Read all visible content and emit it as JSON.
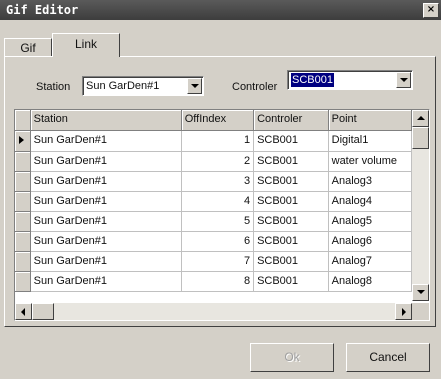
{
  "window": {
    "title": "Gif Editor",
    "close_glyph": "×"
  },
  "tabs": [
    {
      "label": "Gif",
      "active": false
    },
    {
      "label": "Link",
      "active": true
    }
  ],
  "filters": {
    "station_label": "Station",
    "station_value": "Sun GarDen#1",
    "controller_label": "Controler",
    "controller_value": "SCB001"
  },
  "table": {
    "columns": [
      "Station",
      "OffIndex",
      "Controler",
      "Point"
    ],
    "rows": [
      {
        "station": "Sun GarDen#1",
        "offindex": "1",
        "controller": "SCB001",
        "point": "Digital1",
        "current": true
      },
      {
        "station": "Sun GarDen#1",
        "offindex": "2",
        "controller": "SCB001",
        "point": "water volume",
        "current": false
      },
      {
        "station": "Sun GarDen#1",
        "offindex": "3",
        "controller": "SCB001",
        "point": "Analog3",
        "current": false
      },
      {
        "station": "Sun GarDen#1",
        "offindex": "4",
        "controller": "SCB001",
        "point": "Analog4",
        "current": false
      },
      {
        "station": "Sun GarDen#1",
        "offindex": "5",
        "controller": "SCB001",
        "point": "Analog5",
        "current": false
      },
      {
        "station": "Sun GarDen#1",
        "offindex": "6",
        "controller": "SCB001",
        "point": "Analog6",
        "current": false
      },
      {
        "station": "Sun GarDen#1",
        "offindex": "7",
        "controller": "SCB001",
        "point": "Analog7",
        "current": false
      },
      {
        "station": "Sun GarDen#1",
        "offindex": "8",
        "controller": "SCB001",
        "point": "Analog8",
        "current": false
      }
    ]
  },
  "buttons": {
    "ok_label": "Ok",
    "ok_enabled": false,
    "cancel_label": "Cancel"
  },
  "colors": {
    "title_bar": "#3d3d3d",
    "selection": "#000080",
    "face": "#d4d0c8"
  },
  "icons": {
    "close": "close-icon",
    "dropdown": "chevron-down-icon",
    "row_pointer": "row-pointer-icon"
  }
}
